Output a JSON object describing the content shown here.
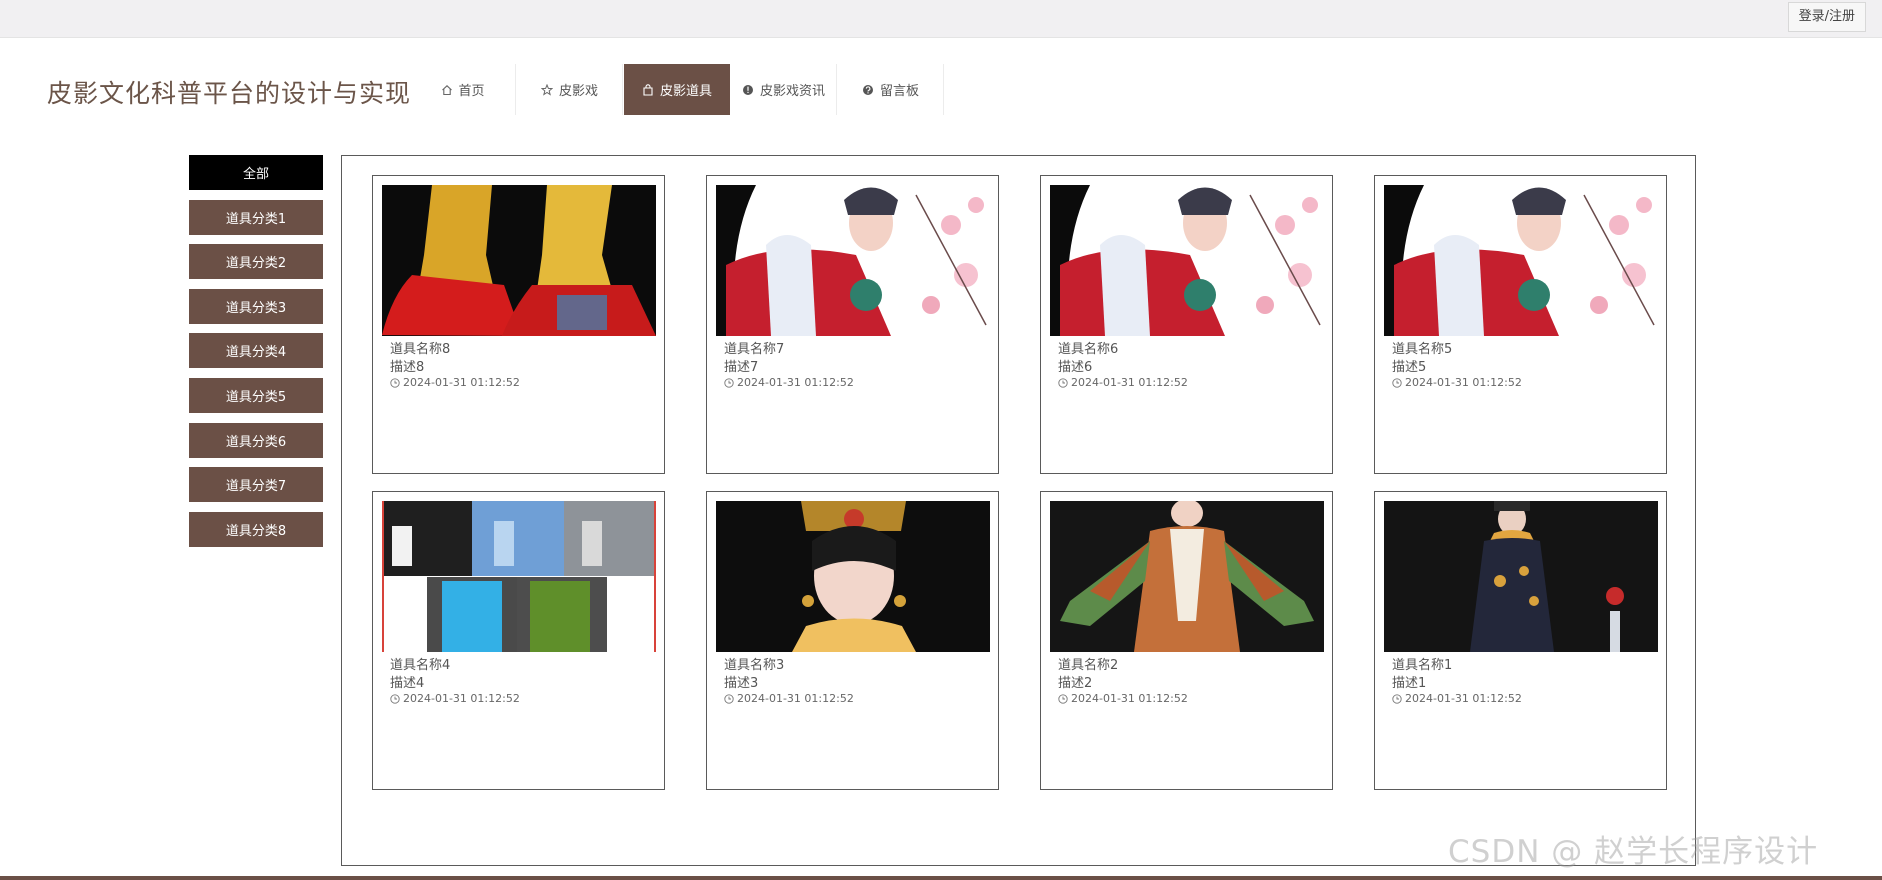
{
  "header": {
    "login_label": "登录/注册",
    "site_title": "皮影文化科普平台的设计与实现"
  },
  "nav": [
    {
      "label": "首页",
      "icon": "home-icon"
    },
    {
      "label": "皮影戏",
      "icon": "star-icon"
    },
    {
      "label": "皮影道具",
      "icon": "bag-icon"
    },
    {
      "label": "皮影戏资讯",
      "icon": "info-icon"
    },
    {
      "label": "留言板",
      "icon": "help-icon"
    }
  ],
  "nav_active": 2,
  "categories": [
    "全部",
    "道具分类1",
    "道具分类2",
    "道具分类3",
    "道具分类4",
    "道具分类5",
    "道具分类6",
    "道具分类7",
    "道具分类8"
  ],
  "items": [
    {
      "name": "道具名称8",
      "desc": "描述8",
      "time": "2024-01-31 01:12:52"
    },
    {
      "name": "道具名称7",
      "desc": "描述7",
      "time": "2024-01-31 01:12:52"
    },
    {
      "name": "道具名称6",
      "desc": "描述6",
      "time": "2024-01-31 01:12:52"
    },
    {
      "name": "道具名称5",
      "desc": "描述5",
      "time": "2024-01-31 01:12:52"
    },
    {
      "name": "道具名称4",
      "desc": "描述4",
      "time": "2024-01-31 01:12:52"
    },
    {
      "name": "道具名称3",
      "desc": "描述3",
      "time": "2024-01-31 01:12:52"
    },
    {
      "name": "道具名称2",
      "desc": "描述2",
      "time": "2024-01-31 01:12:52"
    },
    {
      "name": "道具名称1",
      "desc": "描述1",
      "time": "2024-01-31 01:12:52"
    }
  ],
  "watermark": "CSDN @ 赵学长程序设计",
  "colors": {
    "accent": "#6b5046",
    "active_category": "#000000",
    "topbar": "#f1f0f2"
  }
}
